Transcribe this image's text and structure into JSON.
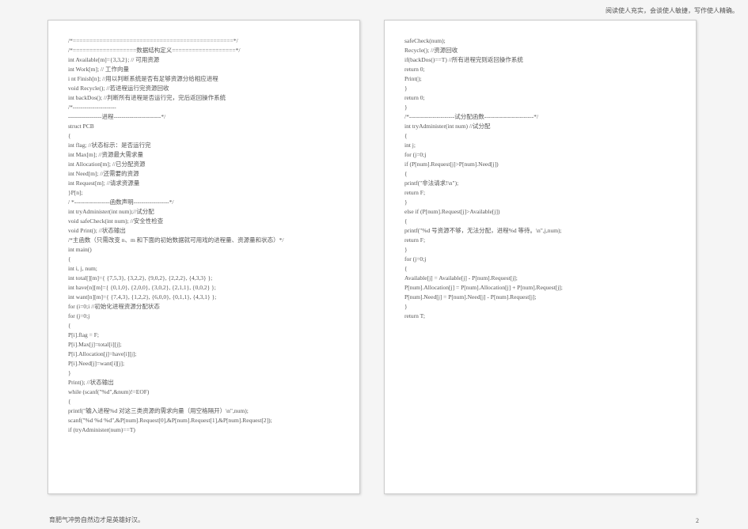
{
  "topRightNote": "阅读使人充实，会谈使人敏捷，写作使人精确。",
  "bottomLeftNote": "育肥气冲势自然边才是英雄好汉。",
  "bottomRightNum": "2",
  "page1": {
    "lines": [
      "      /*================================================*/",
      "      /*===================数据结构定义===================*/",
      "      int Available[m]={3,3,2};  // 可用资源",
      "      int Work[m];               // 工作向量",
      "i nt Finish[n];              //用以判断系统是否有足够资源分给相应进程",
      "void Recycle();              //若进程运行完资源回收",
      "int backDos();               //判断所有进程是否运行完，完后返回操作系统",
      "/*----------------------",
      "-----------------进程------------------------*/",
      " struct PCB",
      " {",
      "     int flag;             //状态标示：是否运行完",
      "     int Max[m];           //资源最大需求量",
      "     int Allocation[m];    //已分配资源",
      "     int Need[m];          //还需要的资源",
      "     int Request[m];       //请求资源量",
      "  }P[n];",
      "",
      "/ *------------------函数声明------------------*/",
      "int tryAdminister(int num);//试分配",
      "void safeCheck(int num);    //安全性检查",
      "void Print();               //状态输出",
      "/*主函数（只需改变 n、m 和下面的初始数据就可用戏的进程量、资源量和状态）*/",
      "int main()",
      "{",
      "     int i, j, num;",
      "     int total[][m]={ {7,5,3}, {3,2,2}, {9,0,2}, {2,2,2}, {4,3,3} };",
      "     int have[n][m]={ {0,1,0}, {2,0,0}, {3,0,2}, {2,1,1}, {0,0,2} };",
      "     int want[n][m]={ {7,4,3}, {1,2,2}, {6,0,0}, {0,1,1}, {4,3,1} };",
      "",
      "     for (i=0;i                       //初始化进程资源分配状态",
      "         for (j=0;j",
      "             {",
      "             P[i].flag = F;",
      "             P[i].Max[j]=total[i][j];",
      "             P[i].Allocation[j]=have[i][j];",
      "             P[i].Need[j]=want[i][j];",
      "         }",
      "",
      "     Print();                         //状态输出",
      "",
      "     while (scanf(\"%d\",&num)!=EOF)",
      "       {",
      "         printf(\"输入进程%d 对这三类资源的需求向量（用空格隔开）\\n\",num);",
      "         scanf(\"%d %d %d\",&P[num].Request[0],&P[num].Request[1],&P[num].Request[2]);",
      "",
      "         if (tryAdminister(num)==T)"
    ]
  },
  "page2": {
    "lines": [
      "             safeCheck(num);",
      "",
      "         Recycle();                          //资源回收",
      "         if(backDos()==T)                    //所有进程完则返回操作系统",
      "    return 0;",
      "",
      "         Print();",
      "     }",
      "",
      "    return 0;",
      "",
      "}",
      "",
      " /*-----------------------试分配函数-------------------------*/",
      " int tryAdminister(int num)                             //试分配",
      " {",
      "              int j;",
      "         for (j=0;j",
      "           if (P[num].Request[j]>P[num].Need[j])",
      "           {",
      "",
      "                         printf(\"非法请求!\\n\");",
      "",
      "             return F;",
      "           }",
      "           else if (P[num].Request[j]>Available[j])",
      "           {",
      "             printf(\"%d 号资源不够，无法分配，进程%d 等待。\\n\",j,num);",
      "             return F;",
      "           }",
      "",
      "     for (j=0;j",
      "     {",
      "         Available[j] = Available[j] - P[num].Request[j];",
      "         P[num].Allocation[j] = P[num].Allocation[j] + P[num].Request[j];",
      "         P[num].Need[j]  = P[num].Need[j]  - P[num].Request[j];",
      "     }",
      "",
      "     return T;"
    ]
  }
}
